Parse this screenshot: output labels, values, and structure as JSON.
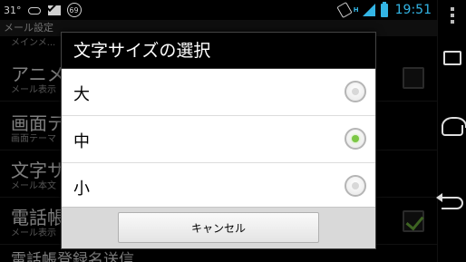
{
  "status_bar": {
    "temperature": "31°",
    "badge_count": "69",
    "network_type": "H",
    "time": "19:51"
  },
  "background": {
    "title": "メール設定",
    "partial_row_text": "メインメ...",
    "rows": [
      {
        "title": "アニメ",
        "subtitle": "メール表示",
        "checked": false
      },
      {
        "title": "画面テ",
        "subtitle": "画面テーマ"
      },
      {
        "title": "文字サ",
        "subtitle": "メール本文"
      },
      {
        "title": "電話帳",
        "subtitle": "メール表示",
        "checked": true
      },
      {
        "title": "電話帳登録名送信",
        "subtitle": ""
      }
    ]
  },
  "dialog": {
    "title": "文字サイズの選択",
    "options": [
      {
        "label": "大",
        "selected": false
      },
      {
        "label": "中",
        "selected": true
      },
      {
        "label": "小",
        "selected": false
      }
    ],
    "cancel_label": "キャンセル"
  },
  "colors": {
    "accent_blue": "#33b5e5",
    "radio_selected": "#7bc744"
  },
  "icons": [
    "cloud-icon",
    "gmail-icon",
    "vibrate-icon",
    "signal-icon",
    "battery-icon",
    "menu-icon",
    "recent-apps-icon",
    "home-icon",
    "back-icon"
  ]
}
